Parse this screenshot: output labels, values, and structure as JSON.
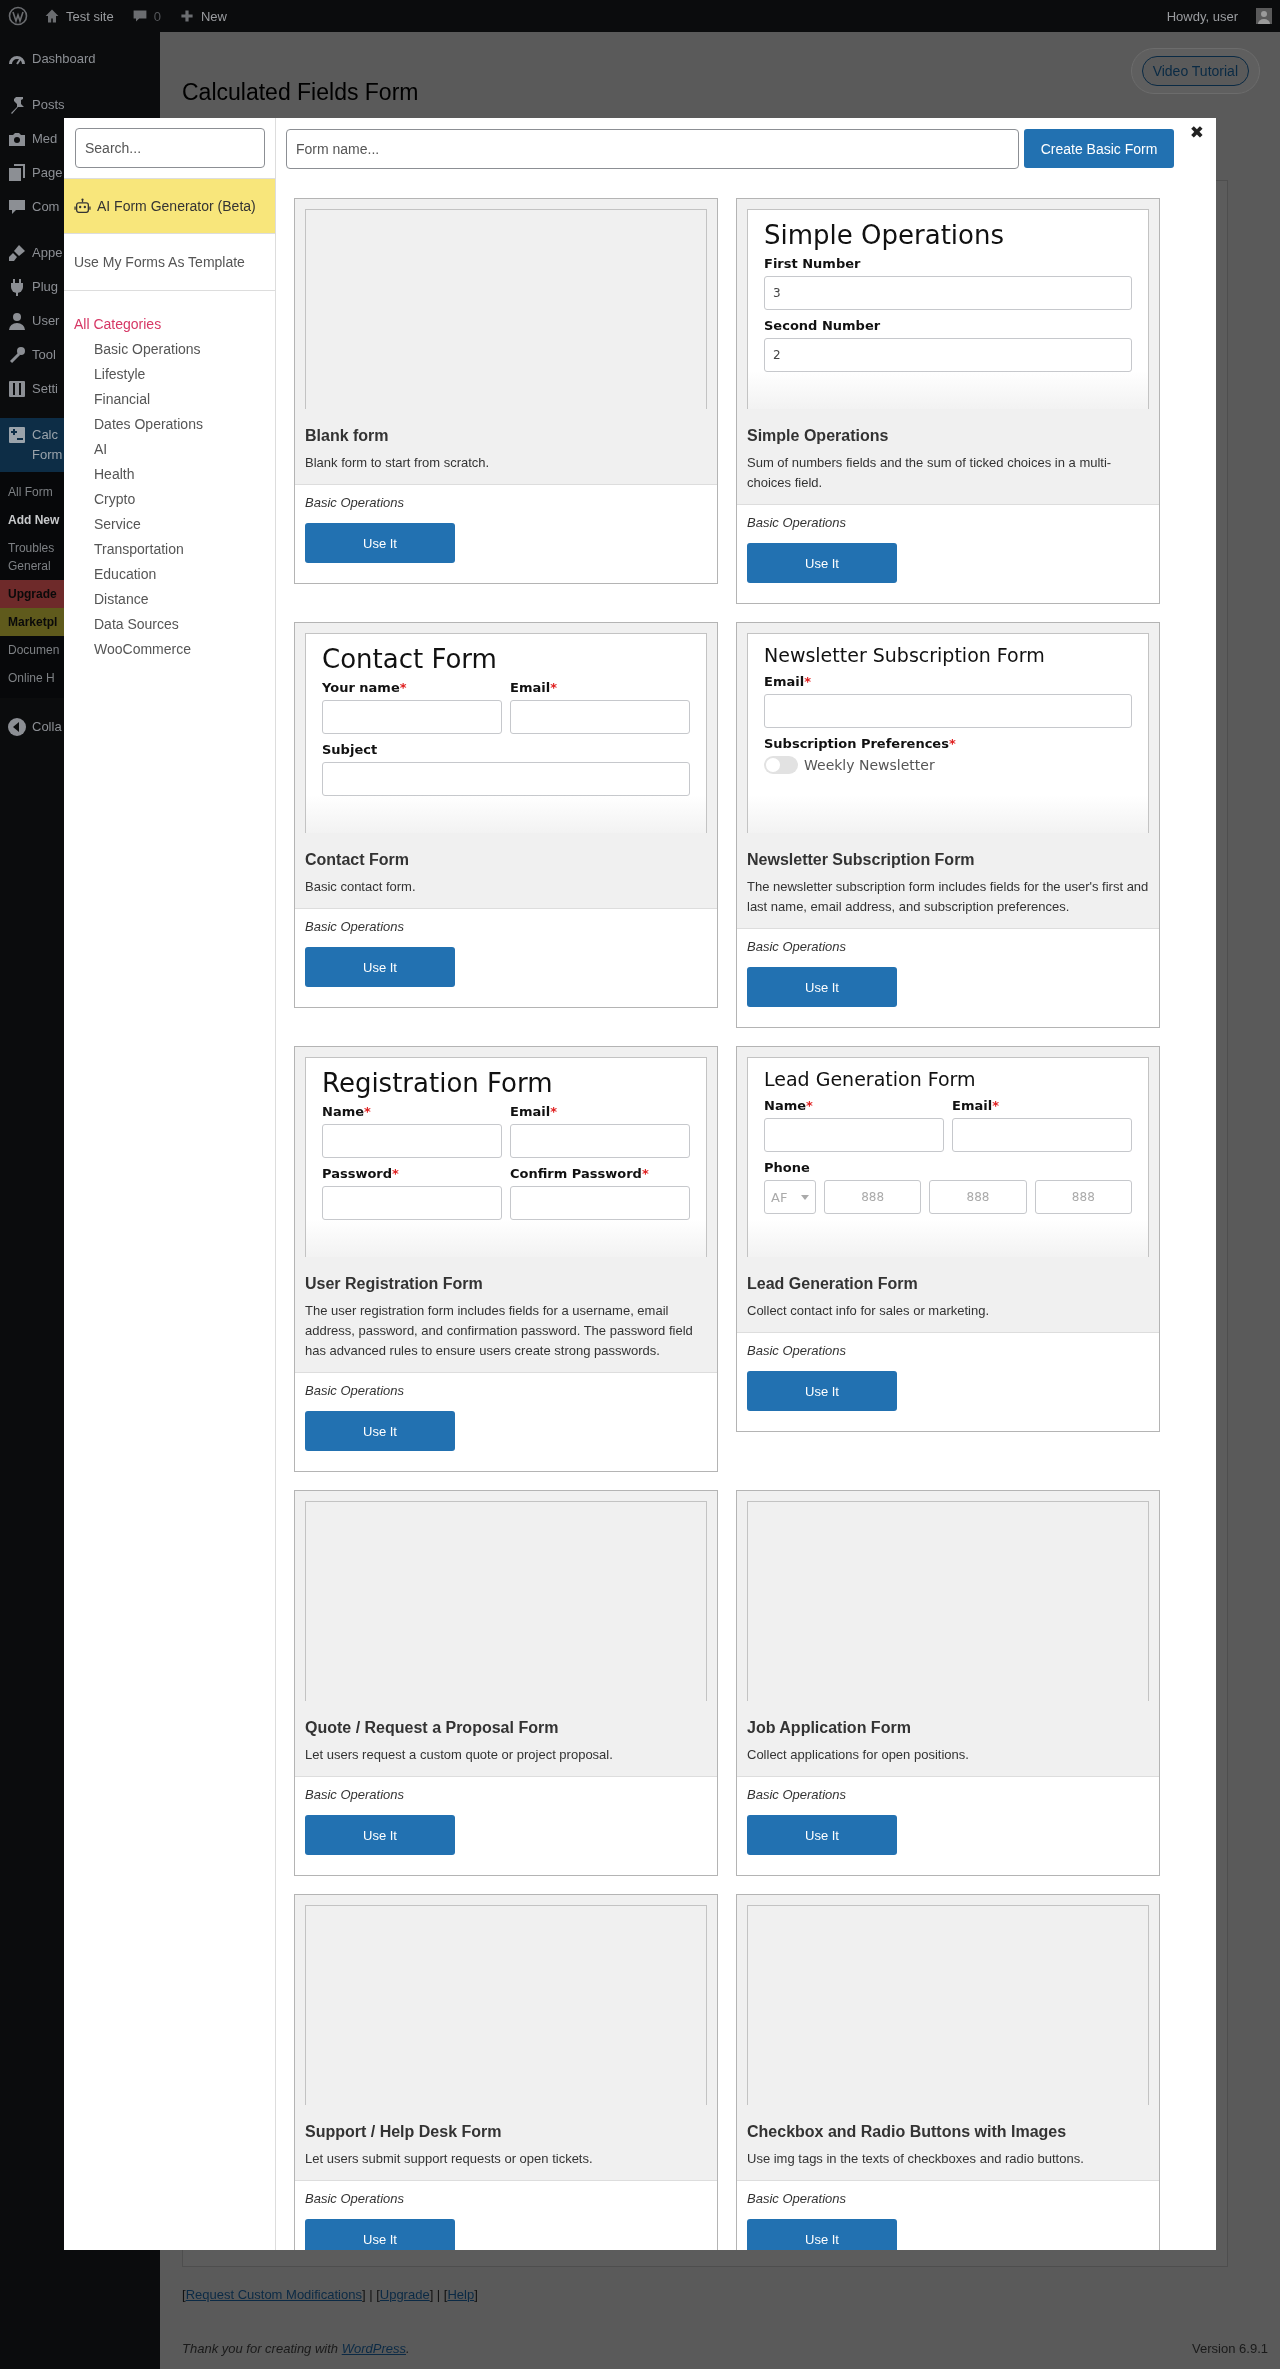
{
  "admin_bar": {
    "site": "Test site",
    "comments": "0",
    "new": "New",
    "greeting": "Howdy, user"
  },
  "admin_menu": {
    "groups": [
      {
        "items": [
          {
            "label": "Dashboard",
            "selected": false
          }
        ]
      },
      {
        "items": [
          {
            "label": "Posts",
            "selected": false
          },
          {
            "label": "Med",
            "selected": false
          },
          {
            "label": "Page",
            "selected": false
          },
          {
            "label": "Com",
            "selected": false
          }
        ]
      },
      {
        "items": [
          {
            "label": "Appe",
            "selected": false
          },
          {
            "label": "Plug",
            "selected": false
          },
          {
            "label": "User",
            "selected": false
          },
          {
            "label": "Tool",
            "selected": false
          },
          {
            "label": "Setti",
            "selected": false
          }
        ]
      },
      {
        "items": [
          {
            "label": "Calc",
            "label_2": "Form",
            "selected": true,
            "children": [
              {
                "label": "All Form",
                "selected": false
              },
              {
                "label": "Add New",
                "selected": true
              },
              {
                "label": "Troubles",
                "label_2": "General",
                "selected": false
              },
              {
                "label": "Upgrade",
                "selected": false,
                "color": "#6e2a2a"
              },
              {
                "label": "Marketpl",
                "selected": false,
                "color": "#5f5a1c"
              },
              {
                "label": "Documen",
                "selected": false
              },
              {
                "label": "Online H",
                "selected": false
              }
            ]
          }
        ]
      }
    ],
    "collapse": "Colla"
  },
  "page": {
    "title": "Calculated Fields Form",
    "video_button": "Video Tutorial",
    "links": [
      {
        "text": "[",
        "link": false
      },
      {
        "text": "Request Custom Modifications",
        "link": true
      },
      {
        "text": "] | [",
        "link": false
      },
      {
        "text": "Upgrade",
        "link": true
      },
      {
        "text": "] | [",
        "link": false
      },
      {
        "text": "Help",
        "link": true
      },
      {
        "text": "]",
        "link": false
      }
    ],
    "footer": [
      {
        "text": "Thank you for creating with ",
        "link": false
      },
      {
        "text": "WordPress",
        "link": true
      },
      {
        "text": ".",
        "link": false
      }
    ],
    "version": "Version 6.9.1"
  },
  "modal": {
    "search_placeholder": "Search...",
    "ai_label": "AI Form Generator (Beta)",
    "templates_label": "Use My Forms As Template",
    "categories": [
      {
        "label": "All Categories",
        "selected": true,
        "children": [
          {
            "label": "Basic Operations",
            "selected": false
          },
          {
            "label": "Lifestyle",
            "selected": false
          },
          {
            "label": "Financial",
            "selected": false
          },
          {
            "label": "Dates Operations",
            "selected": false
          },
          {
            "label": "AI",
            "selected": false
          },
          {
            "label": "Health",
            "selected": false
          },
          {
            "label": "Crypto",
            "selected": false
          },
          {
            "label": "Service",
            "selected": false
          },
          {
            "label": "Transportation",
            "selected": false
          },
          {
            "label": "Education",
            "selected": false
          },
          {
            "label": "Distance",
            "selected": false
          },
          {
            "label": "Data Sources",
            "selected": false
          },
          {
            "label": "WooCommerce",
            "selected": false
          }
        ]
      }
    ],
    "form_name_placeholder": "Form name...",
    "create_button": "Create Basic Form",
    "close": "✖",
    "previews": [
      {
        "kind": "blank"
      },
      {
        "kind": "form",
        "title": "Simple Operations",
        "rows": [
          [
            {
              "kind": "input",
              "label": "First Number",
              "value": "3"
            }
          ],
          [
            {
              "kind": "input",
              "label": "Second Number",
              "value": "2"
            }
          ]
        ]
      },
      {
        "kind": "form",
        "title": "Contact Form",
        "rows": [
          [
            {
              "kind": "input",
              "label": "Your name",
              "required_mark": "*"
            },
            {
              "kind": "input",
              "label": "Email",
              "required_mark": "*"
            }
          ],
          [
            {
              "kind": "input",
              "label": "Subject"
            }
          ]
        ]
      },
      {
        "kind": "form",
        "title": "Newsletter Subscription Form",
        "rows": [
          [
            {
              "kind": "input",
              "label": "Email",
              "required_mark": "*"
            }
          ],
          [
            {
              "kind": "toggles",
              "label": "Subscription Preferences",
              "required_mark": "*",
              "options": [
                {
                  "label": "Weekly Newsletter",
                  "on": false
                }
              ]
            }
          ]
        ]
      },
      {
        "kind": "form",
        "title": "Registration Form",
        "rows": [
          [
            {
              "kind": "input",
              "label": "Name",
              "required_mark": "*"
            },
            {
              "kind": "input",
              "label": "Email",
              "required_mark": "*"
            }
          ],
          [
            {
              "kind": "input",
              "label": "Password",
              "required_mark": "*"
            },
            {
              "kind": "input",
              "label": "Confirm Password",
              "required_mark": "*"
            }
          ]
        ]
      },
      {
        "kind": "form",
        "title": "Lead Generation Form",
        "rows": [
          [
            {
              "kind": "input",
              "label": "Name",
              "required_mark": "*"
            },
            {
              "kind": "input",
              "label": "Email",
              "required_mark": "*"
            }
          ],
          [
            {
              "kind": "phone",
              "label": "Phone",
              "country": "AF",
              "parts": [
                "888",
                "888",
                "888"
              ]
            }
          ]
        ]
      },
      {
        "kind": "blank"
      },
      {
        "kind": "blank"
      },
      {
        "kind": "blank"
      },
      {
        "kind": "blank"
      }
    ],
    "templates": [
      {
        "title": "Blank form",
        "description": "Blank form to start from scratch.",
        "category": "Basic Operations",
        "button": "Use It"
      },
      {
        "title": "Simple Operations",
        "description": "Sum of numbers fields and the sum of ticked choices in a multi-choices field.",
        "category": "Basic Operations",
        "button": "Use It"
      },
      {
        "title": "Contact Form",
        "description": "Basic contact form.",
        "category": "Basic Operations",
        "button": "Use It"
      },
      {
        "title": "Newsletter Subscription Form",
        "description": "The newsletter subscription form includes fields for the user's first and last name, email address, and subscription preferences.",
        "category": "Basic Operations",
        "button": "Use It"
      },
      {
        "title": "User Registration Form",
        "description": "The user registration form includes fields for a username, email address, password, and confirmation password. The password field has advanced rules to ensure users create strong passwords.",
        "category": "Basic Operations",
        "button": "Use It"
      },
      {
        "title": "Lead Generation Form",
        "description": "Collect contact info for sales or marketing.",
        "category": "Basic Operations",
        "button": "Use It"
      },
      {
        "title": "Quote / Request a Proposal Form",
        "description": "Let users request a custom quote or project proposal.",
        "category": "Basic Operations",
        "button": "Use It"
      },
      {
        "title": "Job Application Form",
        "description": "Collect applications for open positions.",
        "category": "Basic Operations",
        "button": "Use It"
      },
      {
        "title": "Support / Help Desk Form",
        "description": "Let users submit support requests or open tickets.",
        "category": "Basic Operations",
        "button": "Use It"
      },
      {
        "title": "Checkbox and Radio Buttons with Images",
        "description": "Use img tags in the texts of checkboxes and radio buttons.",
        "category": "Basic Operations",
        "button": "Use It"
      }
    ]
  }
}
